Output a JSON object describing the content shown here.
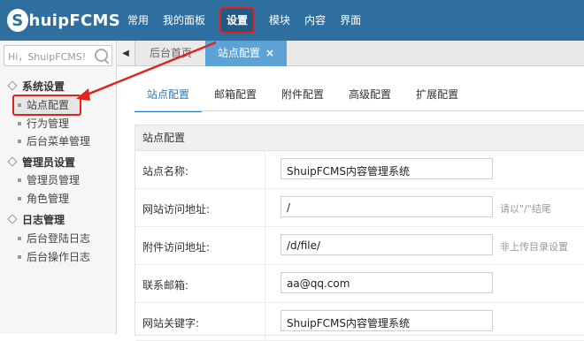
{
  "app": {
    "logo_mark": "S",
    "logo_text": "huipFCMS"
  },
  "nav": {
    "items": [
      "常用",
      "我的面板",
      "设置",
      "模块",
      "内容",
      "界面"
    ],
    "active_index": 2
  },
  "sidebar": {
    "search_placeholder": "Hi，ShuipFCMS!",
    "groups": [
      {
        "label": "系统设置",
        "items": [
          "站点配置",
          "行为管理",
          "后台菜单管理"
        ]
      },
      {
        "label": "管理员设置",
        "items": [
          "管理员管理",
          "角色管理"
        ]
      },
      {
        "label": "日志管理",
        "items": [
          "后台登陆日志",
          "后台操作日志"
        ]
      }
    ]
  },
  "tabs": {
    "back_icon": "◀",
    "home_label": "后台首页",
    "current_label": "站点配置",
    "close_icon": "×"
  },
  "subtabs": [
    "站点配置",
    "邮箱配置",
    "附件配置",
    "高级配置",
    "扩展配置"
  ],
  "panel": {
    "title": "站点配置",
    "rows": [
      {
        "label": "站点名称:",
        "value": "ShuipFCMS内容管理系统",
        "hint": ""
      },
      {
        "label": "网站访问地址:",
        "value": "/",
        "hint": "请以\"/\"结尾"
      },
      {
        "label": "附件访问地址:",
        "value": "/d/file/",
        "hint": "非上传目录设置"
      },
      {
        "label": "联系邮箱:",
        "value": "aa@qq.com",
        "hint": ""
      },
      {
        "label": "网站关键字:",
        "value": "ShuipFCMS内容管理系统",
        "hint": ""
      }
    ]
  },
  "colors": {
    "header": "#2f6f9f",
    "highlight": "#e0241b",
    "tab_active": "#5ea3d6"
  }
}
